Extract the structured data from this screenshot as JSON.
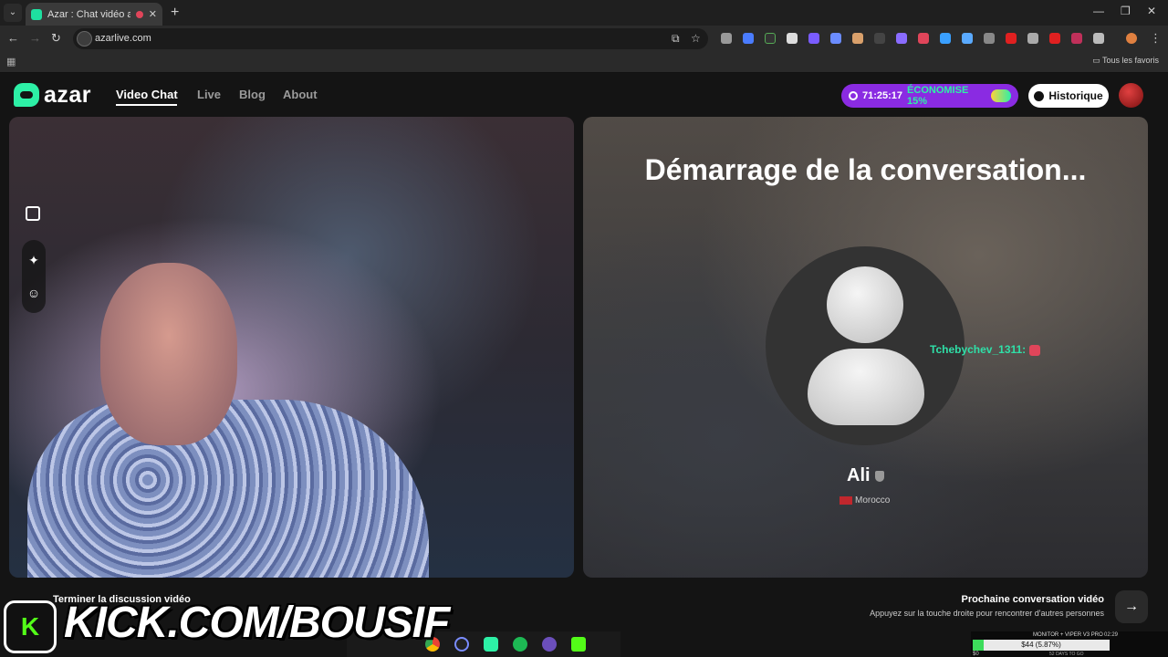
{
  "browser": {
    "tab_title": "Azar : Chat vidéo avec de nouvelles personnes",
    "url": "azarlive.com",
    "bookmarks_folder": "Tous les favoris"
  },
  "header": {
    "logo": "azar",
    "nav": [
      "Video Chat",
      "Live",
      "Blog",
      "About"
    ],
    "promo_timer": "71:25:17",
    "promo_text": "ÉCONOMISE 15%",
    "history_label": "Historique"
  },
  "main": {
    "status_title": "Démarrage de la conversation...",
    "peer_name": "Ali",
    "peer_country": "Morocco",
    "chat_user": "Tchebychev_1311:"
  },
  "footer": {
    "end_label": "Terminer la discussion vidéo",
    "next_title": "Prochaine conversation vidéo",
    "next_sub": "Appuyez sur la touche droite pour rencontrer d'autres personnes",
    "next_arrow": "→"
  },
  "overlay": {
    "kick_letter": "K",
    "kick_url": "KICK.COM/BOUSIF"
  },
  "monitor": {
    "title": "MONITOR + VIPER V3 PRO",
    "value": "$44 (5.87%)",
    "progress": 0.0587,
    "min": "$0",
    "days": "52 DAYS TO GO",
    "time": "02:29"
  },
  "colors": {
    "accent": "#2df0a6",
    "promo": "#8a2be2"
  }
}
